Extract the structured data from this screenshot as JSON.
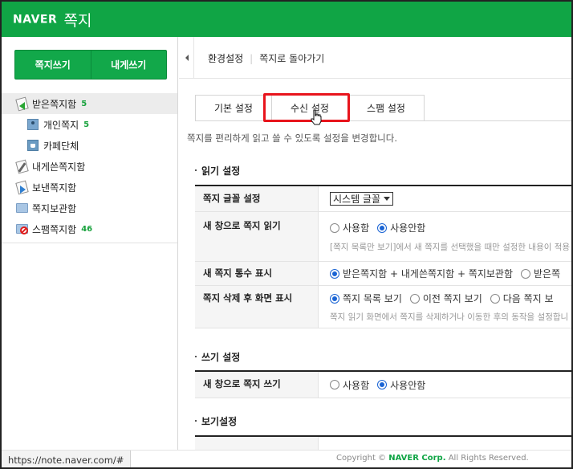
{
  "header": {
    "brand": "NAVER",
    "title": "쪽지"
  },
  "compose": {
    "write": "쪽지쓰기",
    "write_self": "내게쓰기"
  },
  "sidebar": {
    "items": [
      {
        "label": "받은쪽지함",
        "count": "5",
        "icon": "received-mail-icon",
        "active": true
      },
      {
        "label": "개인쪽지",
        "count": "5",
        "icon": "person-icon"
      },
      {
        "label": "카페단체",
        "count": "",
        "icon": "cafe-icon"
      },
      {
        "label": "내게쓴쪽지함",
        "count": "",
        "icon": "self-written-icon"
      },
      {
        "label": "보낸쪽지함",
        "count": "",
        "icon": "sent-mail-icon"
      },
      {
        "label": "쪽지보관함",
        "count": "",
        "icon": "folder-icon"
      },
      {
        "label": "스팸쪽지함",
        "count": "46",
        "icon": "spam-icon"
      }
    ]
  },
  "breadcrumb": {
    "current": "환경설정",
    "back": "쪽지로 돌아가기"
  },
  "tabs": [
    "기본 설정",
    "수신 설정",
    "스팸 설정"
  ],
  "description": "쪽지를 편리하게 읽고 쓸 수 있도록 설정을 변경합니다.",
  "read_settings": {
    "title": "읽기 설정",
    "font_label": "쪽지 글꼴 설정",
    "font_value": "시스템 글꼴",
    "new_window_label": "새 창으로 쪽지 읽기",
    "new_window_opts": [
      "사용함",
      "사용안함"
    ],
    "new_window_help": "[쪽지 목록만 보기]에서 새 쪽지를 선택했을 때만 설정한 내용이 적용",
    "count_label": "새 쪽지 통수 표시",
    "count_opts": [
      "받은쪽지함 + 내게쓴쪽지함 + 쪽지보관함",
      "받은쪽"
    ],
    "after_delete_label": "쪽지 삭제 후 화면 표시",
    "after_delete_opts": [
      "쪽지 목록 보기",
      "이전 쪽지 보기",
      "다음 쪽지 보"
    ],
    "after_delete_help": "쪽지 읽기 화면에서 쪽지를 삭제하거나 이동한 후의 동작을 설정합니"
  },
  "write_settings": {
    "title": "쓰기 설정",
    "new_window_label": "새 창으로 쪽지 쓰기",
    "new_window_opts": [
      "사용함",
      "사용안함"
    ]
  },
  "view_settings": {
    "title": "보기설정"
  },
  "statusbar": {
    "url": "https://note.naver.com/#"
  },
  "footer": {
    "copyright_prefix": "Copyright ©",
    "company": "NAVER Corp.",
    "rights": "All Rights Reserved."
  },
  "colors": {
    "brand": "#10a545",
    "highlight": "#e8141c",
    "radio": "#1a64d4"
  }
}
